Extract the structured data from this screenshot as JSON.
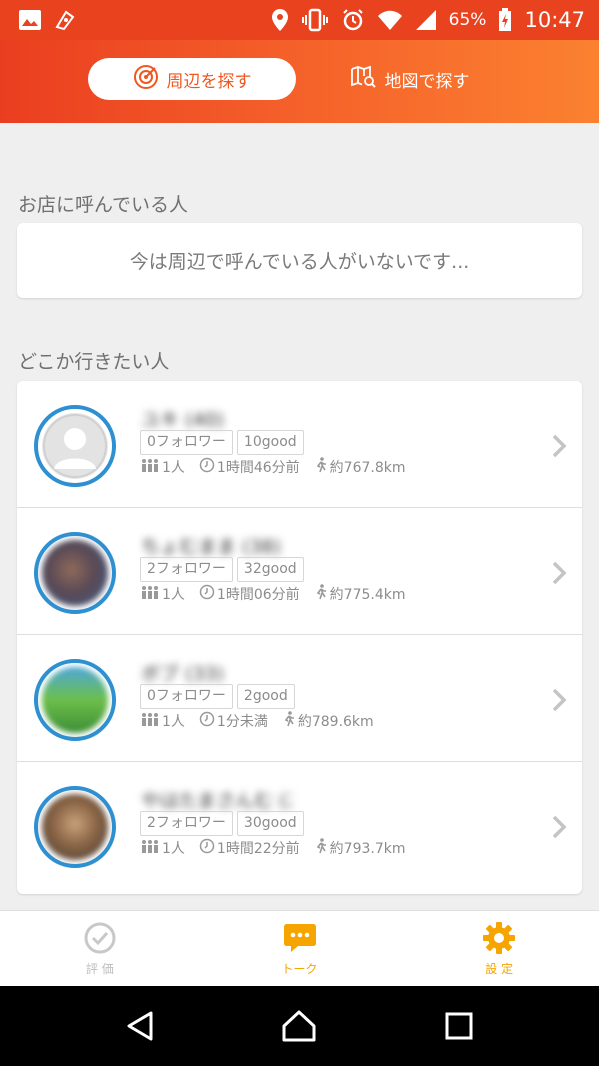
{
  "status_bar": {
    "battery": "65%",
    "time": "10:47"
  },
  "header": {
    "tab_nearby": "周辺を探す",
    "tab_map": "地図で探す"
  },
  "calling_section": {
    "title": "お店に呼んでいる人",
    "empty_text": "今は周辺で呼んでいる人がいないです..."
  },
  "wanting_section": {
    "title": "どこか行きたい人",
    "people": [
      {
        "name": "ユキ (40)",
        "followers": "0フォロワー",
        "good": "10good",
        "people": "1人",
        "time": "1時間46分前",
        "distance": "約767.8km"
      },
      {
        "name": "ちょむまま (38)",
        "followers": "2フォロワー",
        "good": "32good",
        "people": "1人",
        "time": "1時間06分前",
        "distance": "約775.4km"
      },
      {
        "name": "ボブ (33)",
        "followers": "0フォロワー",
        "good": "2good",
        "people": "1人",
        "time": "1分未満",
        "distance": "約789.6km"
      },
      {
        "name": "やはたまさんむ (27)",
        "followers": "2フォロワー",
        "good": "30good",
        "people": "1人",
        "time": "1時間22分前",
        "distance": "約793.7km"
      }
    ]
  },
  "bottom_nav": {
    "eval": "評 価",
    "talk": "トーク",
    "settings": "設 定"
  },
  "colors": {
    "header_start": "#ea3e20",
    "header_end": "#fb8130",
    "avatar_ring": "#2e8fd1",
    "nav_active": "#f5a400"
  }
}
